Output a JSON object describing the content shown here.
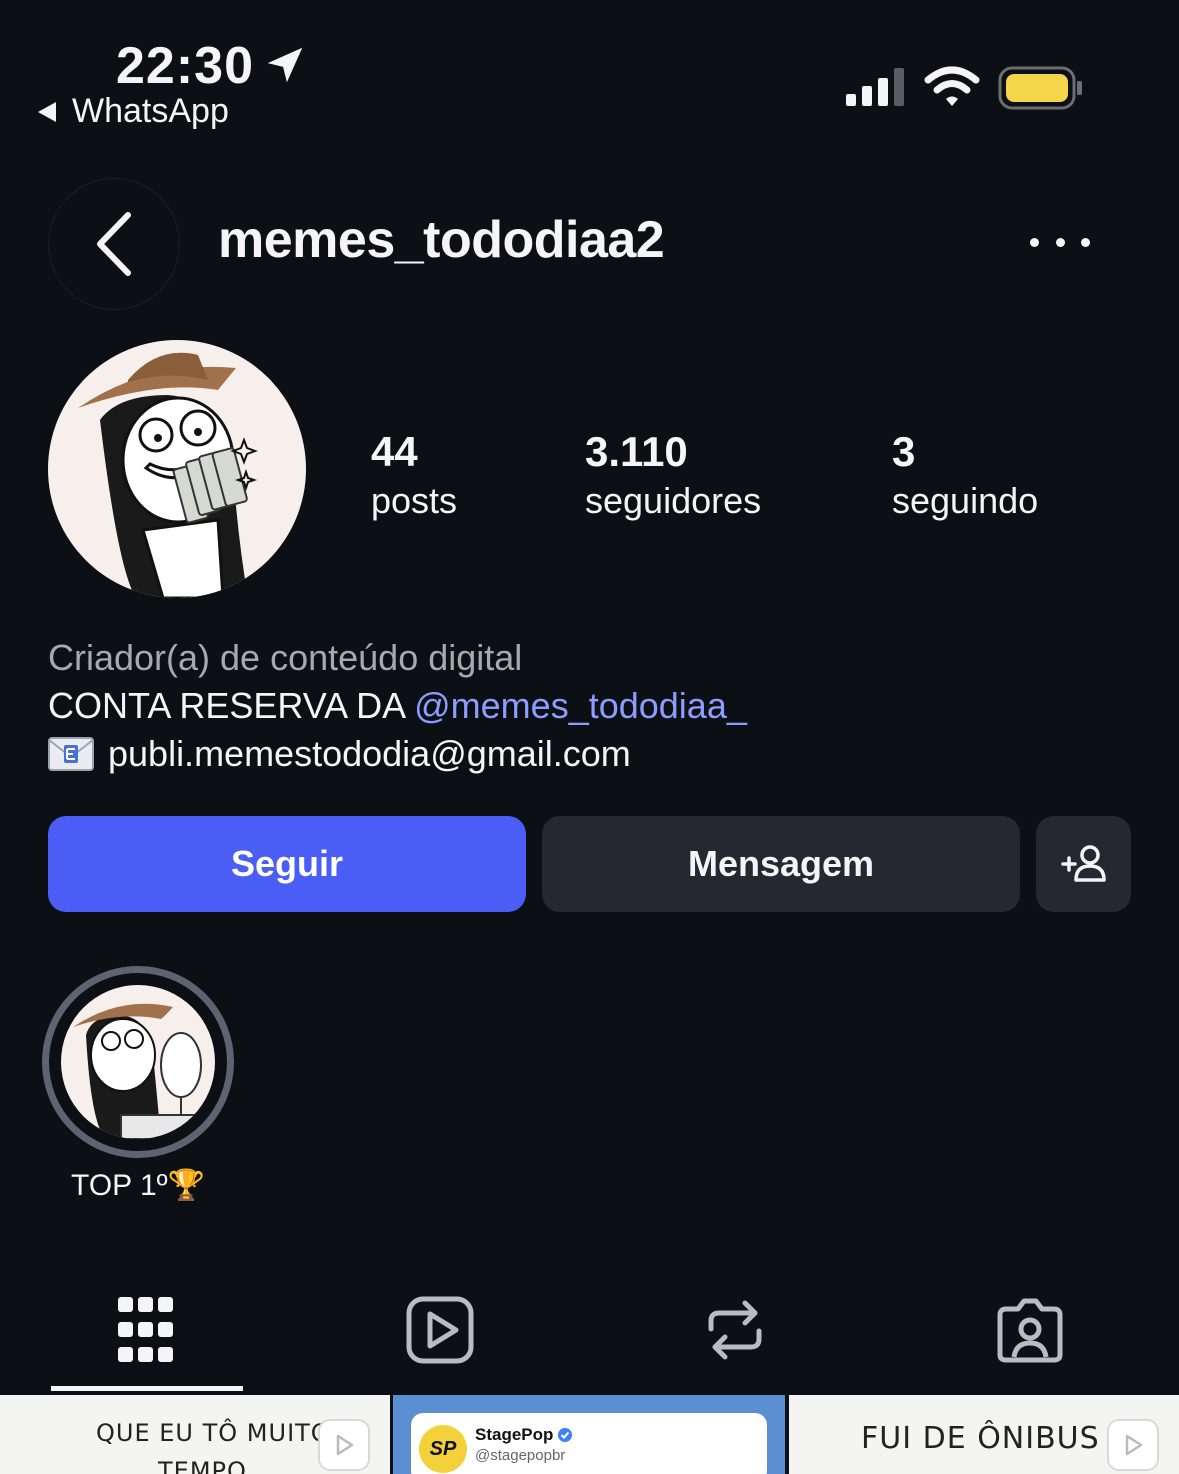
{
  "status_bar": {
    "time": "22:30",
    "back_app": "WhatsApp"
  },
  "header": {
    "username": "memes_tododiaa2"
  },
  "stats": {
    "posts_count": "44",
    "posts_label": "posts",
    "followers_count": "3.110",
    "followers_label": "seguidores",
    "following_count": "3",
    "following_label": "seguindo"
  },
  "bio": {
    "category": "Criador(a) de conteúdo digital",
    "line1_prefix": "CONTA RESERVA DA ",
    "line1_mention": "@memes_tododiaa_",
    "email": "publi.memestododia@gmail.com"
  },
  "actions": {
    "follow": "Seguir",
    "message": "Mensagem"
  },
  "highlights": [
    {
      "label": "TOP 1º🏆"
    }
  ],
  "tabs": [
    "grid-icon",
    "reels-icon",
    "reposts-icon",
    "tagged-icon"
  ],
  "grid": {
    "post1_text_line1": "QUE EU TÔ MUITO",
    "post1_text_line2": "TEMPO",
    "post2_name": "StagePop",
    "post2_handle": "@stagepopbr",
    "post3_text": "FUI DE ÔNIBUS"
  },
  "colors": {
    "background": "#0c0f14",
    "follow_button": "#4a5df5",
    "secondary_button": "#252830",
    "mention": "#8c9cff",
    "battery": "#f5d64a"
  }
}
